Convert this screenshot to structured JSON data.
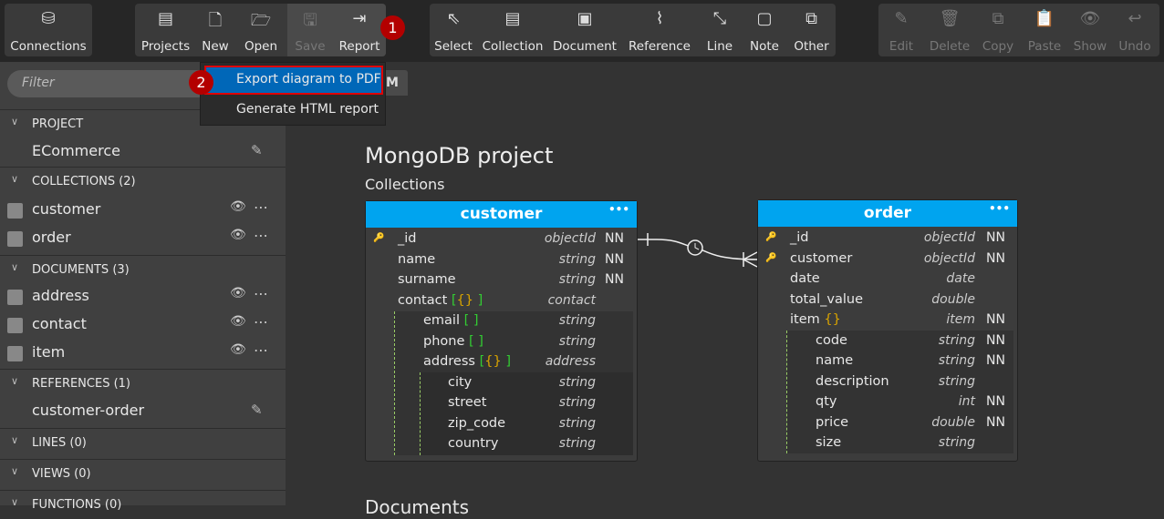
{
  "toolbar": {
    "connections": "Connections",
    "file": [
      "Projects",
      "New",
      "Open",
      "Save",
      "Report"
    ],
    "tools": [
      "Select",
      "Collection",
      "Document",
      "Reference",
      "Line",
      "Note",
      "Other"
    ],
    "edit": [
      "Edit",
      "Delete",
      "Copy",
      "Paste",
      "Show",
      "Undo"
    ]
  },
  "badges": [
    "1",
    "2"
  ],
  "menu": {
    "items": [
      "Export diagram to PDF",
      "Generate HTML report"
    ]
  },
  "sidebar": {
    "filter_placeholder": "Filter",
    "project_header": "PROJECT",
    "project_name": "ECommerce",
    "collections_header": "COLLECTIONS (2)",
    "collections": [
      "customer",
      "order"
    ],
    "documents_header": "DOCUMENTS (3)",
    "documents": [
      "address",
      "contact",
      "item"
    ],
    "references_header": "REFERENCES (1)",
    "references": [
      "customer-order"
    ],
    "lines_header": "LINES (0)",
    "views_header": "VIEWS (0)",
    "functions_header": "FUNCTIONS (0)"
  },
  "tab_label": "M",
  "diagram": {
    "title": "MongoDB project",
    "collections_label": "Collections",
    "documents_label": "Documents",
    "customer": {
      "name": "customer",
      "rows": [
        [
          "_id",
          "objectId",
          "NN"
        ],
        [
          "name",
          "string",
          "NN"
        ],
        [
          "surname",
          "string",
          "NN"
        ],
        [
          "contact",
          "contact",
          ""
        ],
        [
          "email",
          "string",
          ""
        ],
        [
          "phone",
          "string",
          ""
        ],
        [
          "address",
          "address",
          ""
        ],
        [
          "city",
          "string",
          ""
        ],
        [
          "street",
          "string",
          ""
        ],
        [
          "zip_code",
          "string",
          ""
        ],
        [
          "country",
          "string",
          ""
        ]
      ]
    },
    "order": {
      "name": "order",
      "rows": [
        [
          "_id",
          "objectId",
          "NN"
        ],
        [
          "customer",
          "objectId",
          "NN"
        ],
        [
          "date",
          "date",
          ""
        ],
        [
          "total_value",
          "double",
          ""
        ],
        [
          "item",
          "item",
          "NN"
        ],
        [
          "code",
          "string",
          "NN"
        ],
        [
          "name",
          "string",
          "NN"
        ],
        [
          "description",
          "string",
          ""
        ],
        [
          "qty",
          "int",
          "NN"
        ],
        [
          "price",
          "double",
          "NN"
        ],
        [
          "size",
          "string",
          ""
        ]
      ]
    }
  }
}
